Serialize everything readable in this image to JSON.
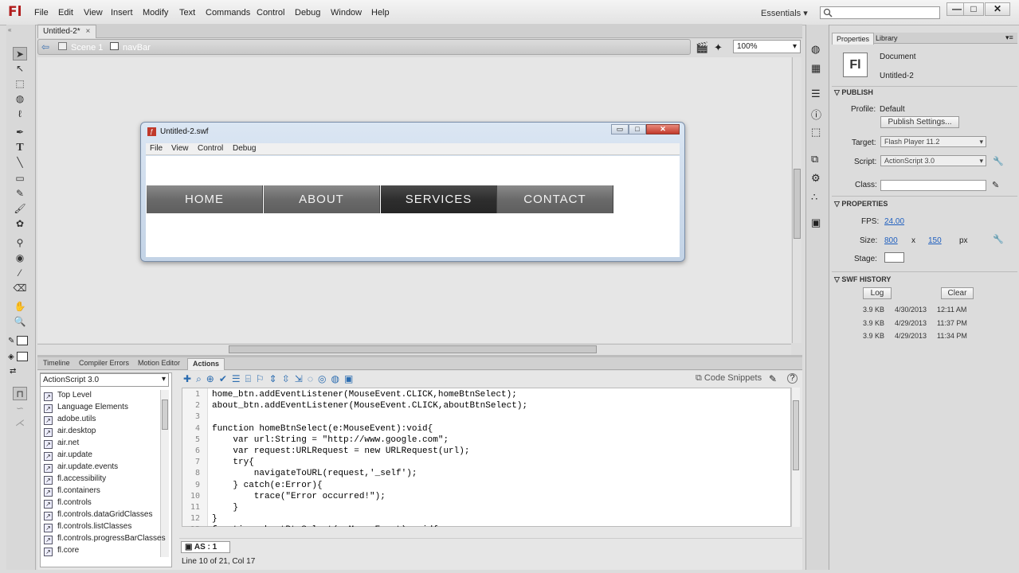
{
  "app": {
    "logo": "Fl",
    "menu": [
      "File",
      "Edit",
      "View",
      "Insert",
      "Modify",
      "Text",
      "Commands",
      "Control",
      "Debug",
      "Window",
      "Help"
    ],
    "workspace": "Essentials",
    "window_controls": [
      "—",
      "□",
      "✕"
    ]
  },
  "document": {
    "tab_label": "Untitled-2*",
    "tab_close": "×",
    "scene": "Scene 1",
    "symbol": "navBar",
    "zoom": "100%"
  },
  "swf_window": {
    "title": "Untitled-2.swf",
    "menu": [
      "File",
      "View",
      "Control",
      "Debug"
    ],
    "nav_buttons": [
      "HOME",
      "ABOUT",
      "SERVICES",
      "CONTACT"
    ],
    "active_button": 2
  },
  "bottom_panel": {
    "tabs": [
      "Timeline",
      "Compiler Errors",
      "Motion Editor",
      "Actions"
    ],
    "active_tab": "Actions",
    "version_select": "ActionScript 3.0",
    "code_snippets": "Code Snippets",
    "tree": [
      "Top Level",
      "Language Elements",
      "adobe.utils",
      "air.desktop",
      "air.net",
      "air.update",
      "air.update.events",
      "fl.accessibility",
      "fl.containers",
      "fl.controls",
      "fl.controls.dataGridClasses",
      "fl.controls.listClasses",
      "fl.controls.progressBarClasses",
      "fl.core"
    ],
    "code_lines": [
      "home_btn.addEventListener(MouseEvent.CLICK,homeBtnSelect);",
      "about_btn.addEventListener(MouseEvent.CLICK,aboutBtnSelect);",
      "",
      "function homeBtnSelect(e:MouseEvent):void{",
      "    var url:String = \"http://www.google.com\";",
      "    var request:URLRequest = new URLRequest(url);",
      "    try{",
      "        navigateToURL(request,'_self');",
      "    } catch(e:Error){",
      "        trace(\"Error occurred!\");",
      "    }",
      "}",
      "function aboutBtnSelect(e:MouseEvent):void{"
    ],
    "file_tab": "AS : 1",
    "status": "Line 10 of 21, Col 17"
  },
  "properties": {
    "tabs": [
      "Properties",
      "Library"
    ],
    "doc_type": "Document",
    "doc_name": "Untitled-2",
    "publish_header": "PUBLISH",
    "profile_label": "Profile:",
    "profile_value": "Default",
    "publish_settings": "Publish Settings...",
    "target_label": "Target:",
    "target_value": "Flash Player 11.2",
    "script_label": "Script:",
    "script_value": "ActionScript 3.0",
    "class_label": "Class:",
    "properties_header": "PROPERTIES",
    "fps_label": "FPS:",
    "fps_value": "24.00",
    "size_label": "Size:",
    "width": "800",
    "x": "x",
    "height": "150",
    "px": "px",
    "stage_label": "Stage:",
    "swf_history_header": "SWF HISTORY",
    "log_btn": "Log",
    "clear_btn": "Clear",
    "history": [
      {
        "size": "3.9 KB",
        "date": "4/30/2013",
        "time": "12:11 AM"
      },
      {
        "size": "3.9 KB",
        "date": "4/29/2013",
        "time": "11:37 PM"
      },
      {
        "size": "3.9 KB",
        "date": "4/29/2013",
        "time": "11:34 PM"
      }
    ]
  }
}
